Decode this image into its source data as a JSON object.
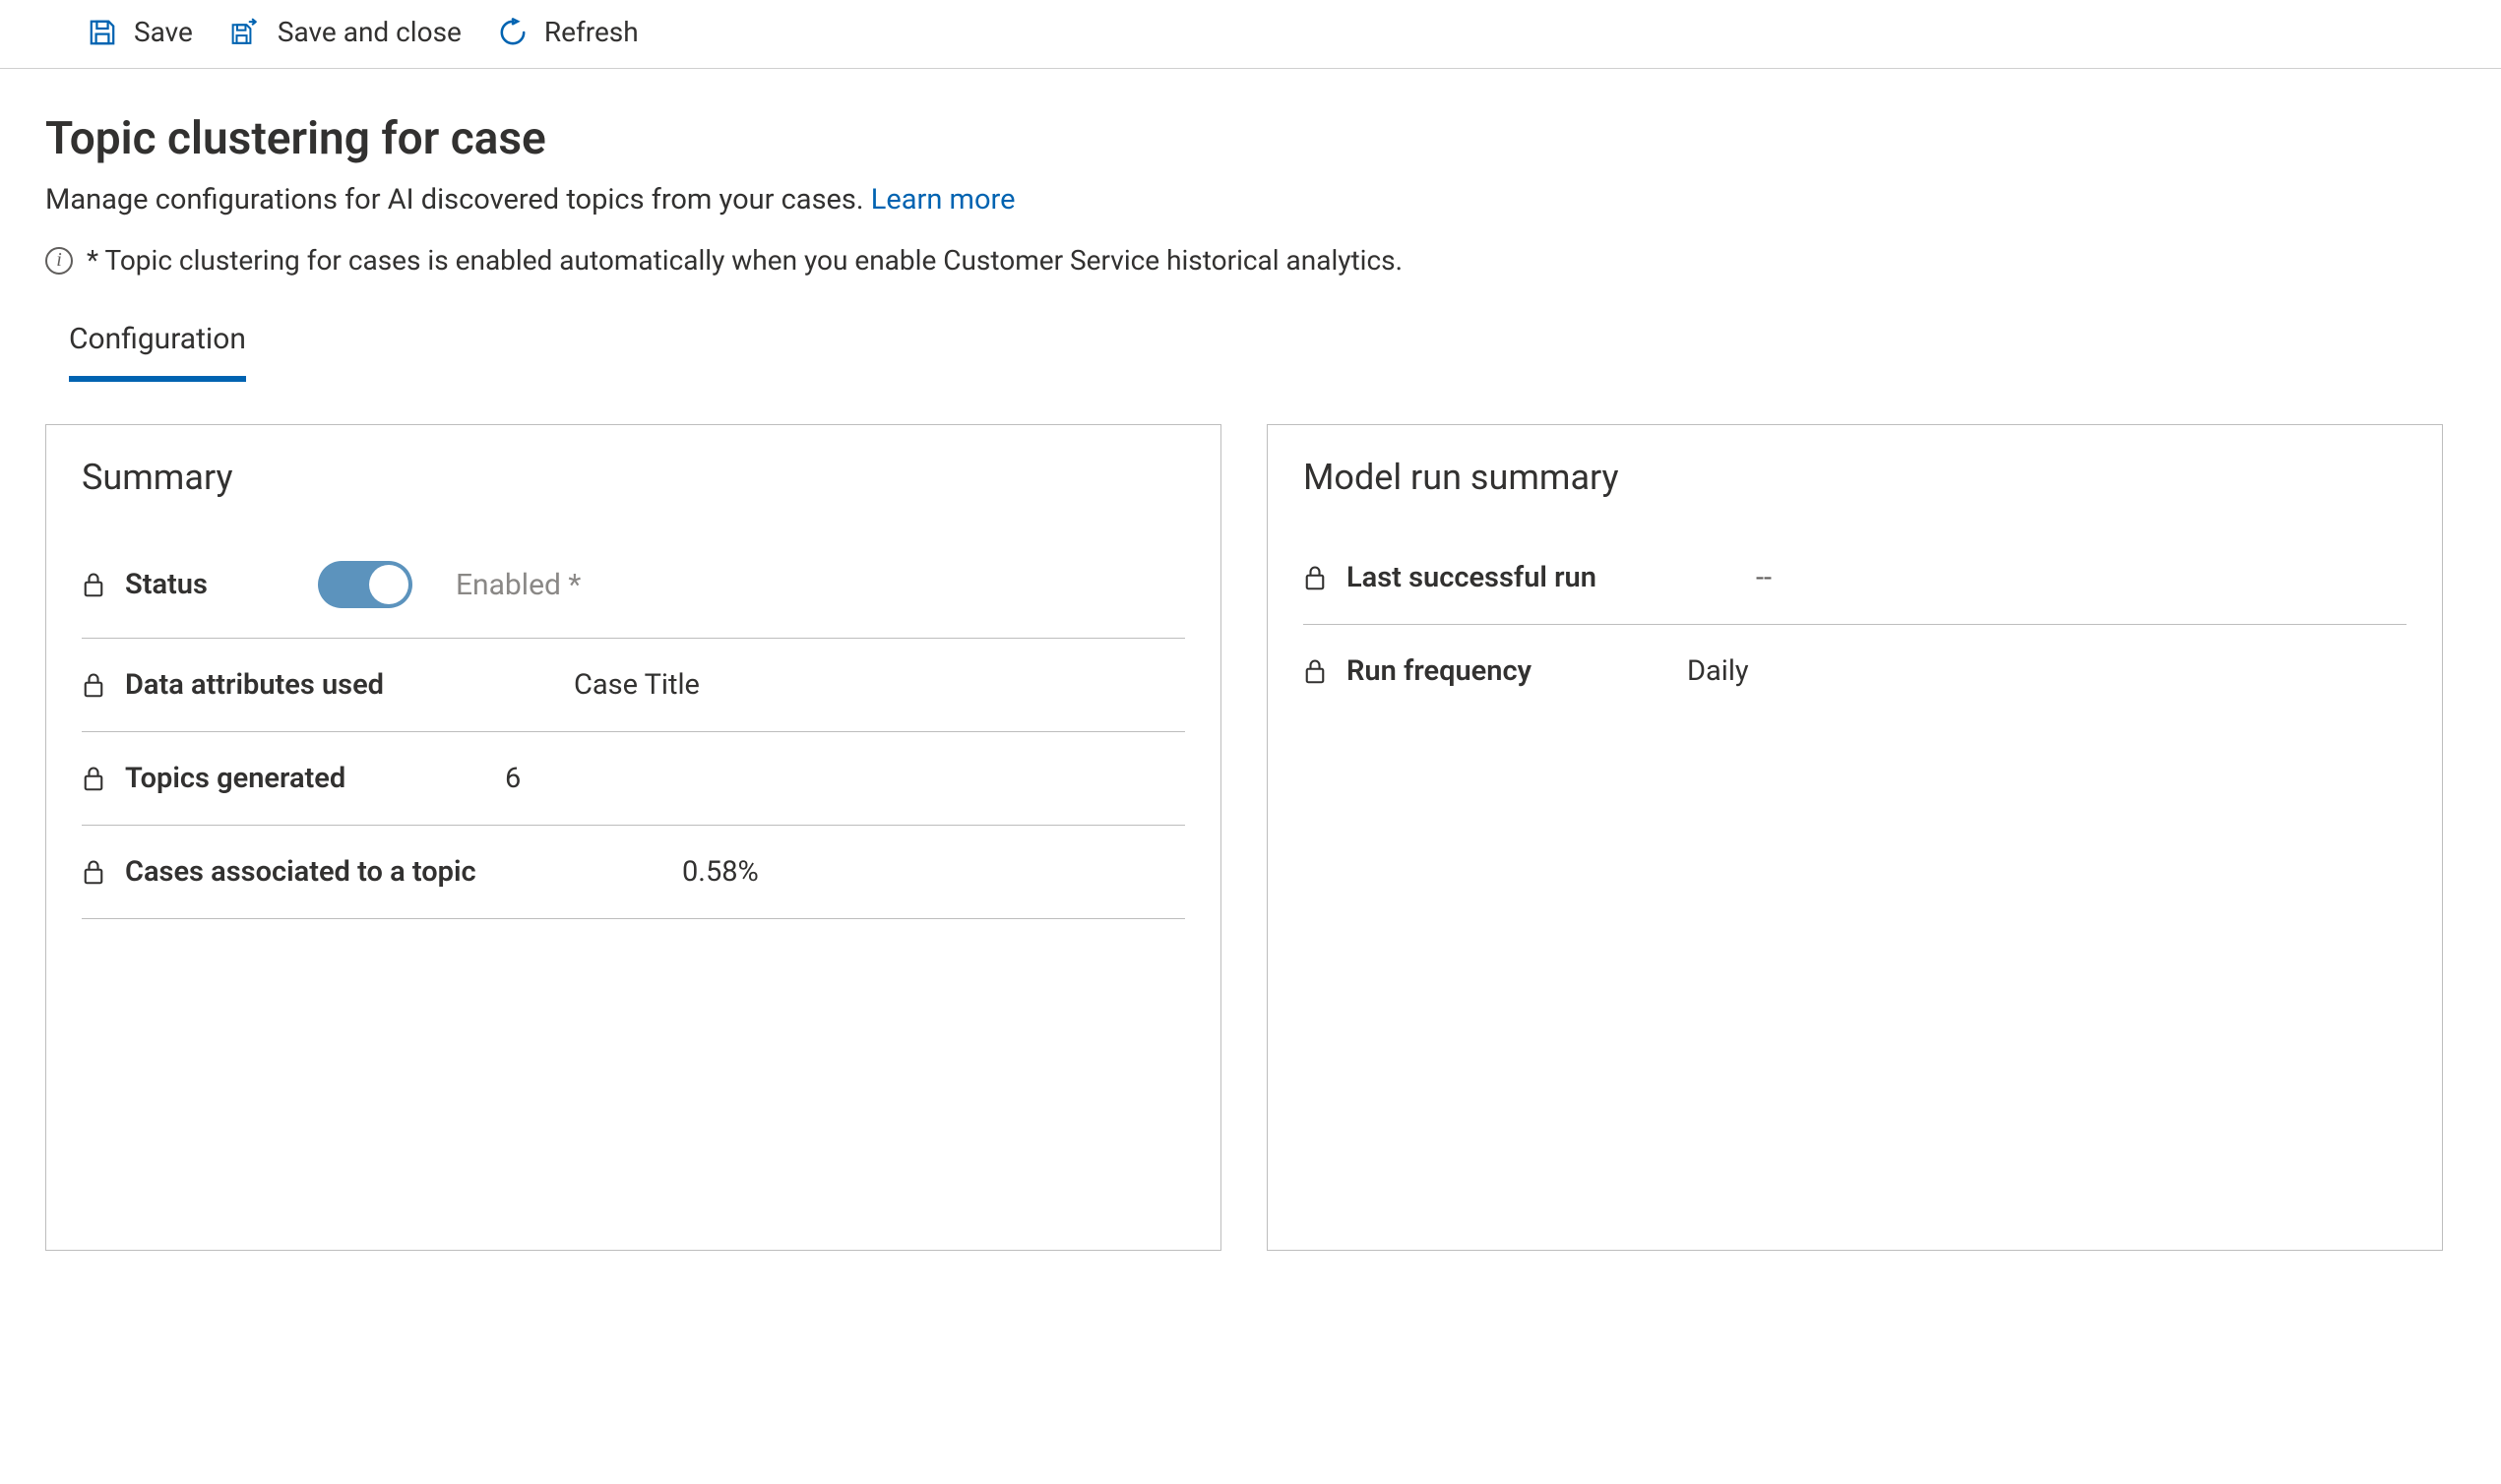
{
  "commandbar": {
    "save": "Save",
    "save_close": "Save and close",
    "refresh": "Refresh"
  },
  "header": {
    "title": "Topic clustering for case",
    "subtitle_text": "Manage configurations for AI discovered topics from your cases. ",
    "learn_more": "Learn more",
    "info_prefix": "* ",
    "info_text": "Topic clustering for cases is enabled automatically when you enable Customer Service historical analytics."
  },
  "tabs": {
    "configuration": "Configuration"
  },
  "summary": {
    "card_title": "Summary",
    "status_label": "Status",
    "status_value": "Enabled *",
    "status_on": true,
    "data_attr_label": "Data attributes used",
    "data_attr_value": "Case Title",
    "topics_label": "Topics generated",
    "topics_value": "6",
    "cases_assoc_label": "Cases associated to a topic",
    "cases_assoc_value": "0.58%"
  },
  "model": {
    "card_title": "Model run summary",
    "last_run_label": "Last successful run",
    "last_run_value": "--",
    "freq_label": "Run frequency",
    "freq_value": "Daily"
  }
}
